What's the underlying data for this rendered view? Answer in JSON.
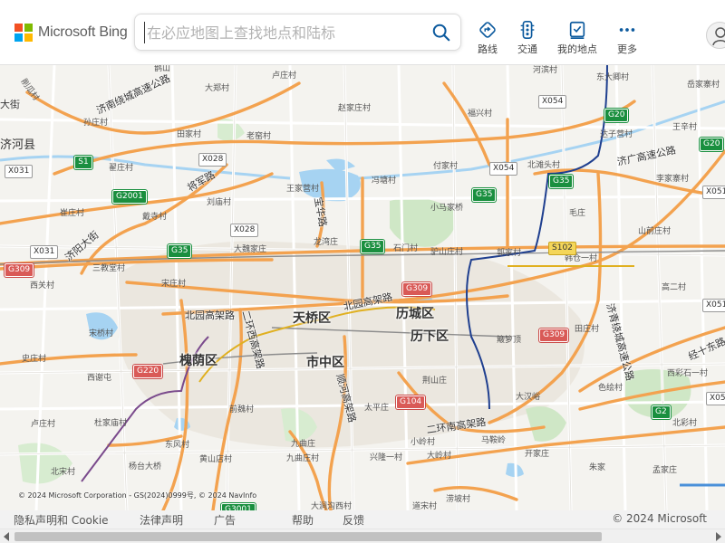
{
  "header": {
    "logo_text": "Microsoft Bing",
    "search_placeholder": "在必应地图上查找地点和陆标",
    "nav": [
      {
        "label": "路线",
        "icon": "directions-icon"
      },
      {
        "label": "交通",
        "icon": "traffic-icon"
      },
      {
        "label": "我的地点",
        "icon": "my-places-icon"
      },
      {
        "label": "更多",
        "icon": "more-icon"
      }
    ]
  },
  "colors": {
    "ms_red": "#f25022",
    "ms_green": "#7fba00",
    "ms_blue": "#00a4ef",
    "ms_yellow": "#ffb900",
    "accent": "#0078d4",
    "major_road": "#f5a04a",
    "minor_road": "#ffffff",
    "water": "#a6d3f2",
    "park": "#cde8c7",
    "urban": "#ebe8e2",
    "rail": "#8c8c8c",
    "metro_blue": "#1f3f8f",
    "metro_purple": "#7a4a8c",
    "metro_yellow": "#e0b020"
  },
  "map": {
    "districts": [
      "天桥区",
      "历城区",
      "历下区",
      "市中区",
      "槐荫区"
    ],
    "counties": [
      "济河县"
    ],
    "roads": [
      "济南绕城高速公路",
      "济广高速公路",
      "北园高架路",
      "将军路",
      "济阳大街",
      "二环西高架路",
      "二环南高架路",
      "顺河高架路",
      "济青绕城高速公路",
      "经十东路",
      "宝华路",
      "大街"
    ],
    "places": [
      "削瓜村",
      "大郑村",
      "卢庄村",
      "鹊山",
      "河滨村",
      "东大卿村",
      "岳家寨村",
      "孙庄村",
      "田家村",
      "老窑村",
      "赵家庄村",
      "福兴村",
      "达子营村",
      "王辛村",
      "翟庄村",
      "王家营村",
      "付家村",
      "北滩头村",
      "李家寨村",
      "刘庙村",
      "戴寺村",
      "冯塘村",
      "小马家桥",
      "毛庄",
      "崔庄村",
      "大魏家庄",
      "龙湾庄",
      "石门村",
      "驴山庄村",
      "郭家村",
      "韩仓一村",
      "山前庄村",
      "三教堂村",
      "宋庄村",
      "高二村",
      "西关村",
      "宋桥村",
      "簸箩顶",
      "田庄村",
      "史庄村",
      "荆山庄",
      "西彩石一村",
      "西谢屯",
      "色绘村",
      "大汉峪",
      "前魏村",
      "太平庄",
      "北彩村",
      "卢庄村",
      "杜家庙村",
      "东风村",
      "九曲庄",
      "小岭村",
      "开家庄",
      "马鞍岭",
      "朱家",
      "孟家庄",
      "北宋村",
      "杨台大桥",
      "九曲庄村",
      "黄山店村",
      "兴隆一村",
      "大岭村",
      "大涧沟西村",
      "涝坡村",
      "道宋村"
    ],
    "shields": [
      {
        "text": "S1",
        "style": "green"
      },
      {
        "text": "G2001",
        "style": "green"
      },
      {
        "text": "G35",
        "style": "green"
      },
      {
        "text": "G20",
        "style": "green"
      },
      {
        "text": "G2",
        "style": "green"
      },
      {
        "text": "G309",
        "style": "red"
      },
      {
        "text": "G220",
        "style": "red"
      },
      {
        "text": "G104",
        "style": "red"
      },
      {
        "text": "X031",
        "style": "white"
      },
      {
        "text": "X028",
        "style": "white"
      },
      {
        "text": "X054",
        "style": "white"
      },
      {
        "text": "X051",
        "style": "white"
      },
      {
        "text": "X05",
        "style": "white"
      },
      {
        "text": "S102",
        "style": "yellow"
      },
      {
        "text": "G3001",
        "style": "green"
      }
    ],
    "copyright": "© 2024 Microsoft Corporation - GS(2024)0999号, © 2024 NavInfo"
  },
  "footer": {
    "links": [
      "隐私声明和 Cookie",
      "法律声明",
      "广告",
      "帮助",
      "反馈"
    ],
    "copyright": "© 2024 Microsoft"
  }
}
